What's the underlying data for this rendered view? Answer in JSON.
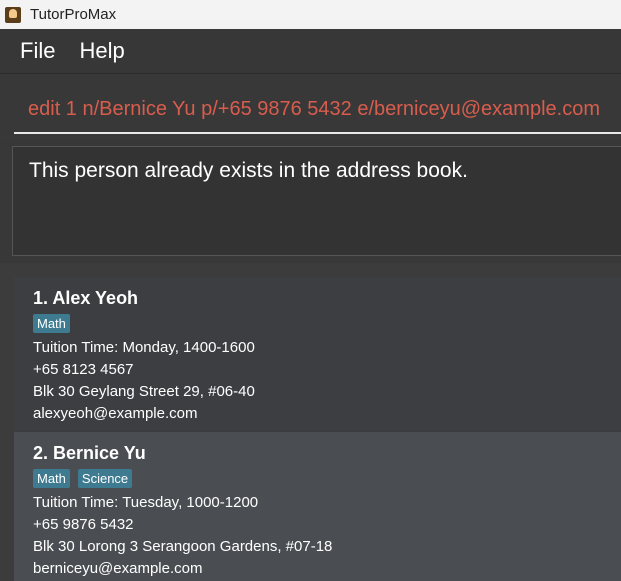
{
  "window": {
    "title": "TutorProMax",
    "icon": "app-icon"
  },
  "menu": {
    "items": [
      "File",
      "Help"
    ]
  },
  "command": {
    "value": "edit 1 n/Bernice Yu p/+65 9876 5432 e/berniceyu@example.com"
  },
  "result": {
    "message": "This person already exists in the address book."
  },
  "persons": [
    {
      "index_name": "1.  Alex Yeoh",
      "tags": [
        "Math"
      ],
      "tuition_time": "Tuition Time: Monday, 1400-1600",
      "phone": "+65 8123 4567",
      "address": "Blk 30 Geylang Street 29, #06-40",
      "email": "alexyeoh@example.com"
    },
    {
      "index_name": "2.  Bernice Yu",
      "tags": [
        "Math",
        "Science"
      ],
      "tuition_time": "Tuition Time: Tuesday, 1000-1200",
      "phone": "+65 9876 5432",
      "address": "Blk 30 Lorong 3 Serangoon Gardens, #07-18",
      "email": "berniceyu@example.com"
    }
  ],
  "colors": {
    "command_text": "#d85d4d",
    "tag_bg": "#3e7b91",
    "selected_card": "#4a4e52"
  }
}
